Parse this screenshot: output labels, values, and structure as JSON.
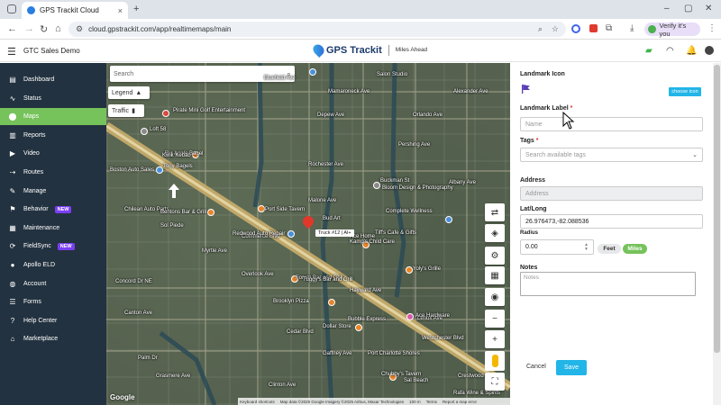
{
  "browser": {
    "tab_title": "GPS Trackit Cloud",
    "tab_close": "×",
    "new_tab": "+",
    "url": "cloud.gpstrackit.com/app/realtimemaps/main",
    "profile_label": "Verify it's you",
    "win_minimize": "–",
    "win_maximize": "▢",
    "win_close": "✕"
  },
  "app_header": {
    "org_name": "GTC Sales Demo",
    "brand": "GPS Trackit",
    "tagline": "Miles Ahead"
  },
  "sidebar": {
    "items": [
      {
        "label": "Dashboard",
        "icon": "dashboard-icon"
      },
      {
        "label": "Status",
        "icon": "status-icon"
      },
      {
        "label": "Maps",
        "icon": "map-pin-icon",
        "active": true
      },
      {
        "label": "Reports",
        "icon": "reports-icon"
      },
      {
        "label": "Video",
        "icon": "video-icon"
      },
      {
        "label": "Routes",
        "icon": "routes-icon"
      },
      {
        "label": "Manage",
        "icon": "wrench-icon"
      },
      {
        "label": "Behavior",
        "icon": "behavior-icon",
        "badge": "NEW"
      },
      {
        "label": "Maintenance",
        "icon": "maintenance-icon"
      },
      {
        "label": "FieldSync",
        "icon": "fieldsync-icon",
        "badge": "NEW"
      },
      {
        "label": "Apollo ELD",
        "icon": "apollo-icon"
      },
      {
        "label": "Account",
        "icon": "account-icon"
      },
      {
        "label": "Forms",
        "icon": "forms-icon"
      },
      {
        "label": "Help Center",
        "icon": "help-icon"
      },
      {
        "label": "Marketplace",
        "icon": "marketplace-icon"
      }
    ]
  },
  "map": {
    "search_placeholder": "Search",
    "legend_label": "Legend",
    "traffic_label": "Traffic",
    "truck_label": "Truck #12 | Al+",
    "google": "Google",
    "attribution": [
      "Keyboard shortcuts",
      "Map data ©2025 Google Imagery ©2025 Airbus, Maxar Technologies",
      "100 m",
      "Terms",
      "Report a map error"
    ],
    "streets": [
      "Mamaroneck Ave",
      "Depew Ave",
      "Alexander Ave",
      "Orlando Ave",
      "Rochester Ave",
      "Malone Ave",
      "Buckman St",
      "Pershing Ave",
      "Bluefield Ave",
      "Albany Ave",
      "Myrtle Ave",
      "Canton Ave",
      "Overlook Ave",
      "Lenox Ave",
      "Westchester Blvd",
      "Concord Dr NE",
      "Grasmere Ave",
      "Cedar Blvd",
      "Palm Dr",
      "Clinton Ave",
      "Gaffney Ave",
      "Commerce Blvd",
      "Hayward Ave",
      "Crestwood Ave"
    ],
    "pois": [
      "Pirate Mini Golf Entertainment",
      "Loft 58",
      "Boston Auto Sales",
      "Big Apple Bagel",
      "Chilean Auto Parts",
      "Kwik Kebab",
      "Tony Bagels",
      "Bentons Bar & Grill",
      "Sol Piede",
      "Redwood Auto Repair",
      "Ace Home",
      "Port Side Tavern",
      "Bud Art",
      "Complete Wellness",
      "Bloom Design & Photography",
      "Kamp's Child Care",
      "Tiff's Cafe & Gifts",
      "Sal Beach",
      "Yoly's Grille",
      "Forum Bar and Grill",
      "Brooklyn Pizza",
      "Dollar Store",
      "Chubby's Tavern",
      "Rafa Wine & Spirits",
      "Tuggy's Bar and Grill",
      "Port Charlotte Shores",
      "Ace Hardware",
      "Bubble Express",
      "Salon Studio"
    ]
  },
  "panel": {
    "landmark_icon_label": "Landmark Icon",
    "choose_icon_label": "choose icon",
    "landmark_label": "Landmark Label",
    "name_placeholder": "Name",
    "tags_label": "Tags",
    "tags_placeholder": "Search available tags",
    "address_label": "Address",
    "address_placeholder": "Address",
    "latlong_label": "Lat/Long",
    "latlong_value": "26.976473,-82.088536",
    "radius_label": "Radius",
    "radius_value": "0.00",
    "unit_feet": "Feet",
    "unit_miles": "Miles",
    "notes_label": "Notes",
    "notes_placeholder": "Notes",
    "cancel_label": "Cancel",
    "save_label": "Save",
    "required_mark": "*"
  },
  "colors": {
    "sidebar_bg": "#233240",
    "active_green": "#76c25b",
    "accent_blue": "#22b5e8",
    "badge_purple": "#7b3ff2"
  }
}
